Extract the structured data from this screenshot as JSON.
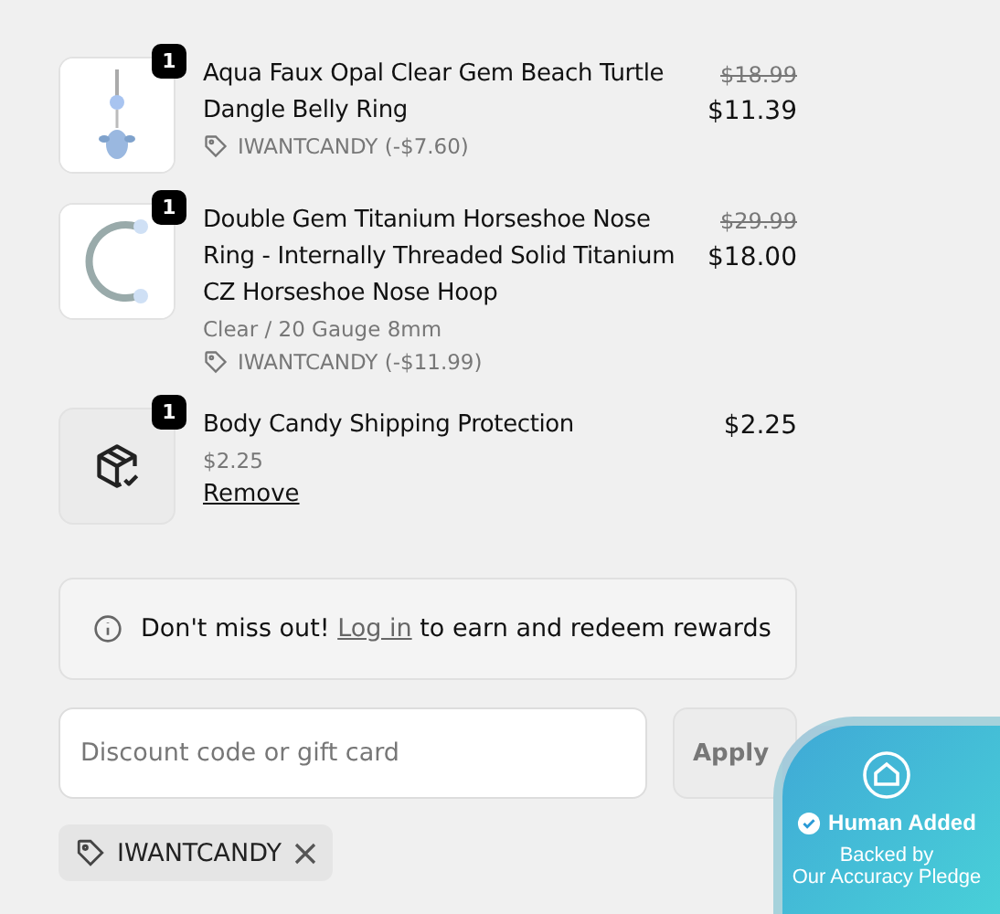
{
  "line_items": [
    {
      "kind": "product",
      "quantity": "1",
      "title": "Aqua Faux Opal Clear Gem Beach Turtle Dangle Belly Ring",
      "original_price": "$18.99",
      "price": "$11.39",
      "discount": "IWANTCANDY (-$7.60)"
    },
    {
      "kind": "product",
      "quantity": "1",
      "title": "Double Gem Titanium Horseshoe Nose Ring - Internally Threaded Solid Titanium CZ Horseshoe Nose Hoop",
      "original_price": "$29.99",
      "price": "$18.00",
      "variant": "Clear / 20 Gauge 8mm",
      "discount": "IWANTCANDY (-$11.99)"
    },
    {
      "kind": "protection",
      "quantity": "1",
      "title": "Body Candy Shipping Protection",
      "price": "$2.25",
      "unit_price": "$2.25",
      "remove": "Remove"
    }
  ],
  "notice": {
    "text": "Don't miss out!",
    "link": "Log in",
    "rest": "to earn and redeem rewards"
  },
  "discount_field": {
    "placeholder": "Discount code or gift card",
    "button": "Apply"
  },
  "applied_code": "IWANTCANDY",
  "trust_badge": {
    "title": "Human Added",
    "line_1": "Backed by",
    "line_2": "Our Accuracy Pledge"
  }
}
